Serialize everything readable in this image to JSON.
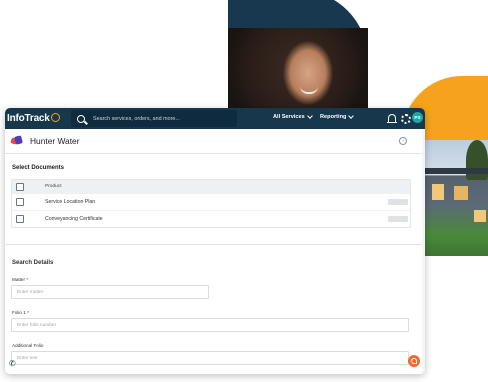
{
  "app": {
    "logo_text": "InfoTrack",
    "search_placeholder": "Search services, orders, and more...",
    "nav": [
      {
        "label": "All Services"
      },
      {
        "label": "Reporting"
      }
    ],
    "avatar_initials": "PS"
  },
  "page": {
    "title": "Hunter Water",
    "help_glyph": "?"
  },
  "documents": {
    "section_title": "Select Documents",
    "column_header": "Product",
    "rows": [
      {
        "label": "Service Location Plan"
      },
      {
        "label": "Conveyancing Certificate"
      }
    ]
  },
  "search_details": {
    "section_title": "Search Details",
    "fields": [
      {
        "label": "Matter *",
        "placeholder": "Enter matter"
      },
      {
        "label": "Folio 1 *",
        "placeholder": "Enter folio number"
      },
      {
        "label": "Additional Folio",
        "placeholder": "Enter text"
      }
    ]
  },
  "colors": {
    "topbar": "#16374c",
    "accent_orange": "#f6a21e",
    "fab": "#f26a2d",
    "avatar": "#1aa9a3"
  }
}
